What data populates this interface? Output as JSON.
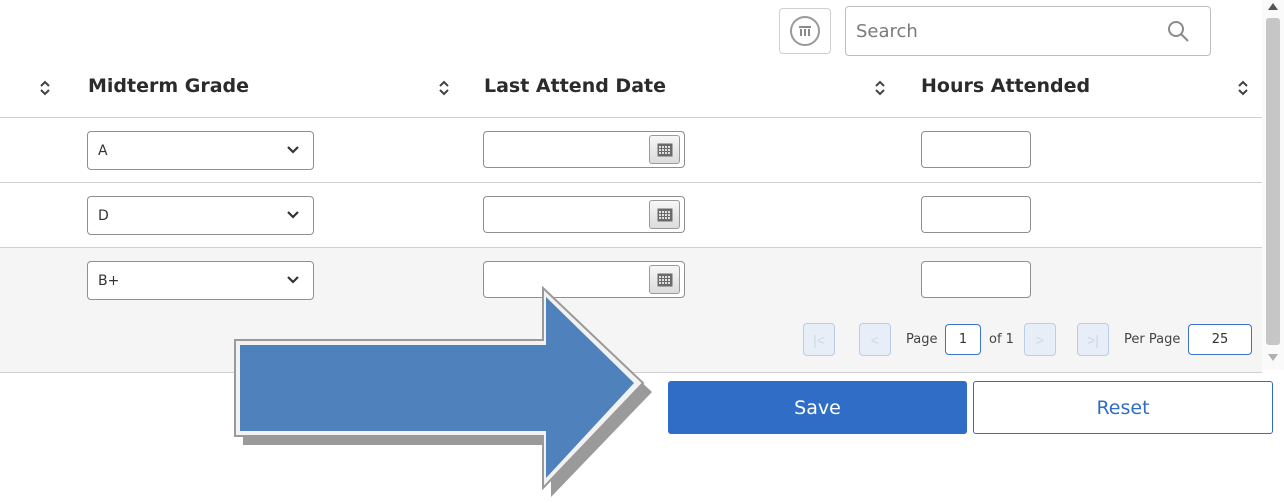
{
  "toolbar": {
    "column_toggle_icon": "columns-icon",
    "search_placeholder": "Search",
    "search_icon": "search-icon"
  },
  "table": {
    "columns": [
      "Midterm Grade",
      "Last Attend Date",
      "Hours Attended"
    ],
    "rows": [
      {
        "midterm_grade": "A",
        "last_attend_date": "",
        "hours_attended": ""
      },
      {
        "midterm_grade": "D",
        "last_attend_date": "",
        "hours_attended": ""
      },
      {
        "midterm_grade": "B+",
        "last_attend_date": "",
        "hours_attended": ""
      }
    ]
  },
  "pager": {
    "page_label": "Page",
    "page_value": "1",
    "of_label": "of 1",
    "per_page_label": "Per Page",
    "per_page_value": "25"
  },
  "actions": {
    "save_label": "Save",
    "reset_label": "Reset"
  },
  "colors": {
    "accent": "#2f6dc6",
    "arrow": "#4f81bd"
  }
}
